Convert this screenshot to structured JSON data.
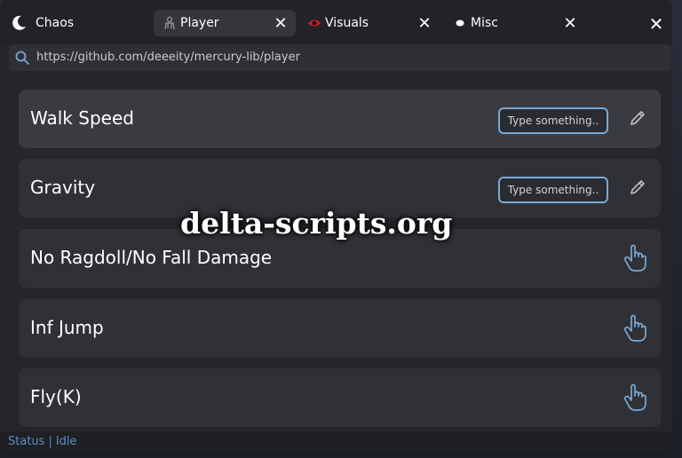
{
  "app": {
    "name": "Chaos"
  },
  "tabs": [
    {
      "label": "Player",
      "active": true,
      "icon": "player-icon"
    },
    {
      "label": "Visuals",
      "active": false,
      "icon": "eye-icon"
    },
    {
      "label": "Misc",
      "active": false,
      "icon": "dot-icon"
    }
  ],
  "address": {
    "url": "https://github.com/deeeity/mercury-lib/player"
  },
  "rows": [
    {
      "title": "Walk Speed",
      "type": "textbox",
      "placeholder": "Type something..",
      "icon": "pencil-icon"
    },
    {
      "title": "Gravity",
      "type": "textbox",
      "placeholder": "Type something..",
      "icon": "pencil-icon"
    },
    {
      "title": "No Ragdoll/No Fall Damage",
      "type": "button",
      "icon": "hand-pointer-icon"
    },
    {
      "title": "Inf Jump",
      "type": "button",
      "icon": "hand-pointer-icon"
    },
    {
      "title": "Fly(K)",
      "type": "button",
      "icon": "hand-pointer-icon"
    }
  ],
  "status": {
    "label": "Status",
    "separator": "|",
    "value": "Idle"
  },
  "watermark": "delta-scripts.org",
  "colors": {
    "accent": "#7aa8d6",
    "status": "#5b8ec5",
    "background": "#25262b",
    "row": "#303136"
  }
}
